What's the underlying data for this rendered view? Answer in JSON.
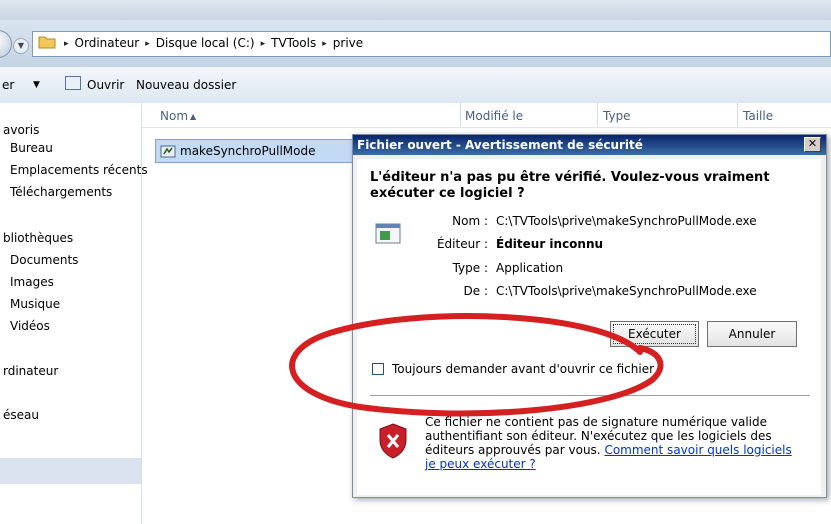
{
  "breadcrumb": {
    "items": [
      "Ordinateur",
      "Disque local (C:)",
      "TVTools",
      "prive"
    ]
  },
  "toolbar": {
    "organize_label": "er",
    "open_label": "Ouvrir",
    "new_folder_label": "Nouveau dossier"
  },
  "nav": {
    "favorites": "avoris",
    "desktop": "Bureau",
    "recent": "Emplacements récents",
    "downloads": "Téléchargements",
    "libraries": "bliothèques",
    "documents": "Documents",
    "images": "Images",
    "music": "Musique",
    "videos": "Vidéos",
    "computer": "rdinateur",
    "network": "éseau"
  },
  "columns": {
    "name": "Nom",
    "modified": "Modifié le",
    "type": "Type",
    "size": "Taille"
  },
  "file": {
    "name": "makeSynchroPullMode"
  },
  "dialog": {
    "title": "Fichier ouvert - Avertissement de sécurité",
    "warning": "L'éditeur n'a pas pu être vérifié. Voulez-vous vraiment exécuter ce logiciel ?",
    "name_label": "Nom :",
    "name_value": "C:\\TVTools\\prive\\makeSynchroPullMode.exe",
    "publisher_label": "Éditeur :",
    "publisher_value": "Éditeur inconnu",
    "type_label": "Type :",
    "type_value": "Application",
    "from_label": "De :",
    "from_value": "C:\\TVTools\\prive\\makeSynchroPullMode.exe",
    "run_button": "Exécuter",
    "cancel_button": "Annuler",
    "checkbox_label": "Toujours demander avant d'ouvrir ce fichier",
    "footer_text": "Ce fichier ne contient pas de signature numérique valide authentifiant son éditeur. N'exécutez que les logiciels des éditeurs approuvés par vous.",
    "footer_link": "Comment savoir quels logiciels je peux exécuter ?"
  },
  "colors": {
    "title_bar": "#0a246a",
    "selection": "#c3daf5",
    "annotation": "#d42020"
  }
}
